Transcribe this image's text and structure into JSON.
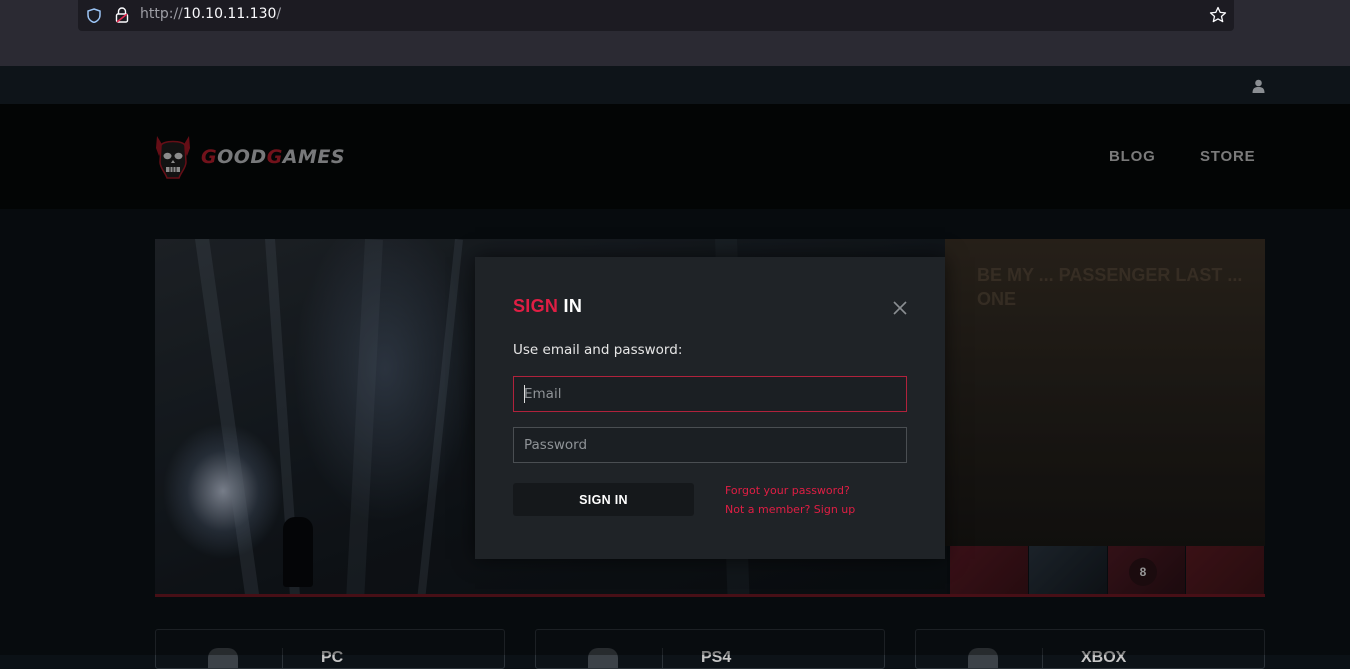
{
  "browser": {
    "url_scheme": "http://",
    "url_host": "10.10.11.130",
    "url_path": "/",
    "icons": [
      "shield-icon",
      "lock-icon",
      "star-icon"
    ]
  },
  "site": {
    "logo_first_letter": "G",
    "logo_word1_rest": "OOD",
    "logo_second_letter": "G",
    "logo_word2_rest": "AMES",
    "nav": {
      "blog": "BLOG",
      "store": "STORE"
    },
    "user_icon": "user-icon",
    "accent_color": "#e01e44"
  },
  "hero": {
    "side_title": "BE MY ... PASSENGER LAST ... ONE",
    "slide_counter": "8"
  },
  "platforms": [
    {
      "label": "PC"
    },
    {
      "label": "PS4"
    },
    {
      "label": "XBOX"
    }
  ],
  "modal": {
    "title_part1": "SIGN",
    "title_part2": "IN",
    "subtitle": "Use email and password:",
    "email_placeholder": "Email",
    "password_placeholder": "Password",
    "signin_button": "SIGN IN",
    "forgot_link": "Forgot your password?",
    "signup_link": "Not a member? Sign up"
  }
}
